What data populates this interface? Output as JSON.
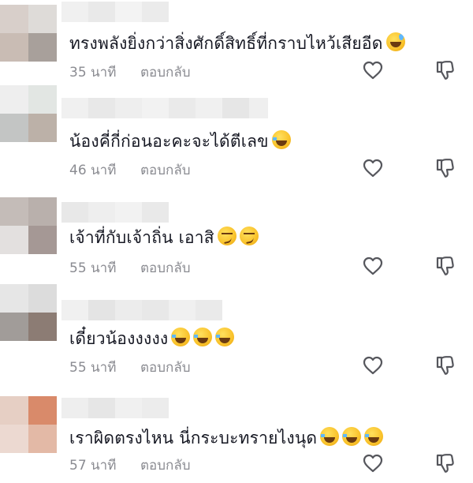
{
  "comments": [
    {
      "text": "ทรงพลังยิ่งกว่าสิ่งศักดิ์สิทธิ์ที่กราบไหว้เสียอีด",
      "emojis": [
        "grinning-sweat-emoji"
      ],
      "time": "35 นาที",
      "reply_label": "ตอบกลับ",
      "avatar_colors": [
        "#d8cfca",
        "#dedbd8",
        "#c9bcb4",
        "#a8a09b"
      ],
      "name_colors": [
        "#f0f0f0",
        "#e9e9e9",
        "#f3f3f3",
        "#ebebeb"
      ]
    },
    {
      "text": "น้องคี่กี่ก่อนอะคะจะได้ตีเลข",
      "emojis": [
        "tears-of-joy-emoji"
      ],
      "time": "46 นาที",
      "reply_label": "ตอบกลับ",
      "avatar_colors": [
        "#eeeeee",
        "#e2e6e3",
        "#c3c5c4",
        "#bcb1a8"
      ],
      "name_colors": [
        "#f0f0f0",
        "#e8e8e8",
        "#eeeeee",
        "#f2f2f2",
        "#eaeaea",
        "#f0f0f0",
        "#e6e6e6",
        "#efefef"
      ]
    },
    {
      "text": "เจ้าที่กับเจ้าถิ่น เอาสิ",
      "emojis": [
        "smirking-face-emoji",
        "smirking-face-emoji"
      ],
      "time": "55 นาที",
      "reply_label": "ตอบกลับ",
      "avatar_colors": [
        "#c4bcb8",
        "#b9b0ac",
        "#e3e0df",
        "#a59895"
      ],
      "name_colors": [
        "#e8e8e8",
        "#eeeeee",
        "#f2f2f2",
        "#e9e9e9"
      ]
    },
    {
      "text": "เดี๋ยวน้องงงงง",
      "emojis": [
        "tears-of-joy-emoji",
        "tears-of-joy-emoji",
        "tears-of-joy-emoji"
      ],
      "time": "55 นาที",
      "reply_label": "ตอบกลับ",
      "avatar_colors": [
        "#e6e6e6",
        "#dcdcdc",
        "#a19c99",
        "#8c7c74"
      ],
      "name_colors": [
        "#f0f0f0",
        "#e4e4e4",
        "#ececec",
        "#e8e8e8",
        "#f0f0f0",
        "#eaeaea"
      ]
    },
    {
      "text": "เราผิดตรงไหน นี่กระบะทรายไงนุด",
      "emojis": [
        "tears-of-joy-emoji",
        "tears-of-joy-emoji",
        "tears-of-joy-emoji"
      ],
      "time": "57 นาที",
      "reply_label": "ตอบกลับ",
      "avatar_colors": [
        "#e6cfc4",
        "#d98a6a",
        "#ecd9d1",
        "#e3b9a6"
      ],
      "name_colors": [
        "#eeeeee",
        "#e6e6e6",
        "#f0f0f0",
        "#ececec"
      ]
    }
  ],
  "icons": {
    "like": "heart-outline-icon",
    "dislike": "thumbs-down-outline-icon"
  }
}
